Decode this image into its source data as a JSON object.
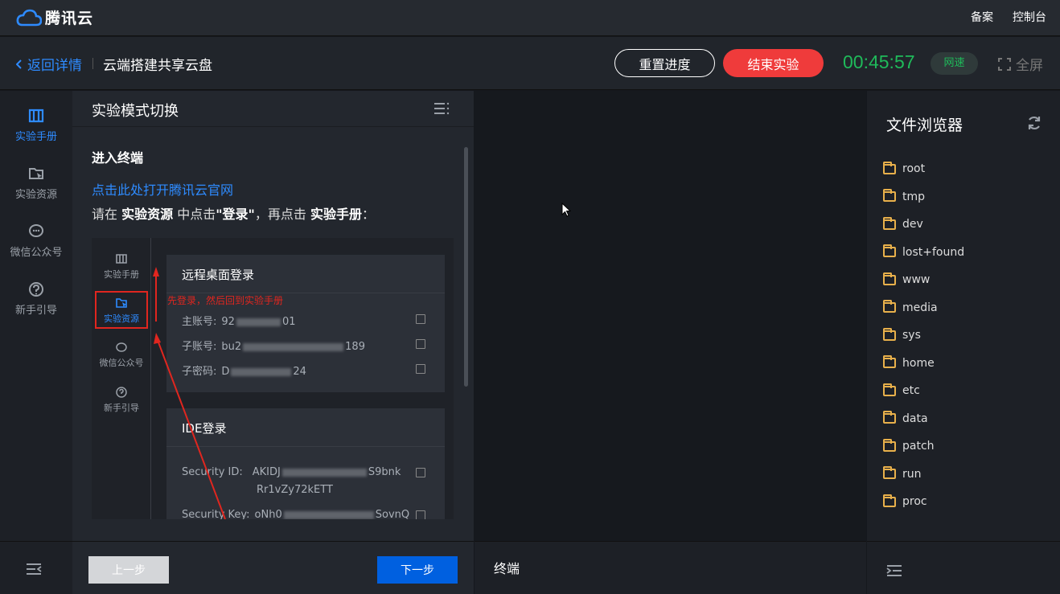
{
  "topbar": {
    "brand": "腾讯云",
    "links": [
      "备案",
      "控制台"
    ]
  },
  "subheader": {
    "back_label": "返回详情",
    "lab_title": "云端搭建共享云盘",
    "reset_label": "重置进度",
    "end_label": "结束实验",
    "timer": "00:45:57",
    "net_badge": "网速",
    "fullscreen_label": "全屏"
  },
  "leftnav": [
    {
      "label": "实验手册",
      "icon": "book-icon",
      "active": true
    },
    {
      "label": "实验资源",
      "icon": "folder-cursor-icon",
      "active": false
    },
    {
      "label": "微信公众号",
      "icon": "chat-icon",
      "active": false
    },
    {
      "label": "新手引导",
      "icon": "question-icon",
      "active": false
    }
  ],
  "manual": {
    "title": "实验模式切换",
    "step_title": "进入终端",
    "open_link": "点击此处打开腾讯云官网",
    "instr": {
      "p1": "请在 ",
      "b1": "实验资源",
      "p2": " 中点击",
      "b2": "\"登录\"",
      "p3": "，再点击 ",
      "b3": "实验手册",
      "p4": "："
    },
    "screenshot": {
      "mini_nav": [
        "实验手册",
        "实验资源",
        "微信公众号",
        "新手引导"
      ],
      "annotation": "先登录，然后回到实验手册",
      "login_card": {
        "title": "远程桌面登录",
        "rows": [
          {
            "label": "主账号:",
            "pre": "92",
            "post": "01"
          },
          {
            "label": "子账号:",
            "pre": "bu2",
            "post": "189"
          },
          {
            "label": "子密码:",
            "pre": "D",
            "post": "24"
          }
        ]
      },
      "ide_card": {
        "title": "IDE登录",
        "rows": [
          {
            "label": "Security ID:",
            "pre": "AKIDJ",
            "post": "S9bnk",
            "line2": "Rr1vZy72kETT"
          },
          {
            "label": "Security Key:",
            "pre": "oNh0",
            "post": "SovnQ"
          }
        ]
      }
    },
    "prev_label": "上一步",
    "next_label": "下一步"
  },
  "terminal": {
    "label": "终端"
  },
  "file_browser": {
    "title": "文件浏览器",
    "items": [
      "root",
      "tmp",
      "dev",
      "lost+found",
      "www",
      "media",
      "sys",
      "home",
      "etc",
      "data",
      "patch",
      "run",
      "proc"
    ]
  },
  "colors": {
    "accent": "#2e8bff",
    "danger": "#ef3b3b",
    "timer": "#1fba5a",
    "folder": "#e8b04b",
    "primary_btn": "#0060e0"
  }
}
